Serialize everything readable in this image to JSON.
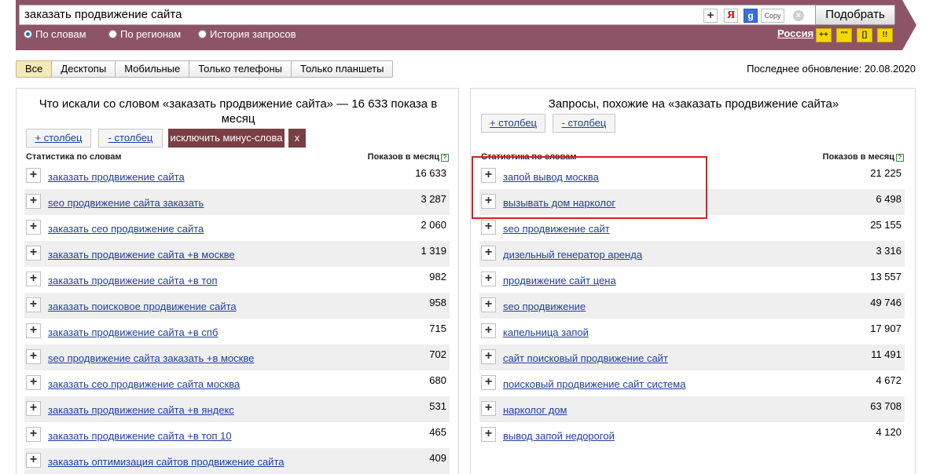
{
  "search": {
    "query": "заказать продвижение сайта",
    "plus_label": "+",
    "yandex_label": "Я",
    "google_label": "g",
    "copy_label": "Copy",
    "clear_label": "×",
    "submit_label": "Подобрать"
  },
  "modes": [
    {
      "label": "По словам",
      "selected": true
    },
    {
      "label": "По регионам",
      "selected": false
    },
    {
      "label": "История запросов",
      "selected": false
    }
  ],
  "region": "Россия",
  "operators": [
    "++",
    "\"\"",
    "[]",
    "!!"
  ],
  "tabs": [
    "Все",
    "Десктопы",
    "Мобильные",
    "Только телефоны",
    "Только планшеты"
  ],
  "active_tab": 0,
  "last_update": "Последнее обновление: 20.08.2020",
  "left": {
    "title": "Что искали со словом «заказать продвижение сайта» — 16 633 показа в месяц",
    "add_col": "+ столбец",
    "remove_col": "- столбец",
    "exclude_minus": "исключить минус-слова",
    "exclude_close": "x",
    "head_left": "Статистика по словам",
    "head_right": "Показов в месяц",
    "rows": [
      {
        "kw": "заказать продвижение сайта",
        "count": "16 633"
      },
      {
        "kw": "seo продвижение сайта заказать",
        "count": "3 287"
      },
      {
        "kw": "заказать сео продвижение сайта",
        "count": "2 060"
      },
      {
        "kw": "заказать продвижение сайта +в москве",
        "count": "1 319"
      },
      {
        "kw": "заказать продвижение сайта +в топ",
        "count": "982"
      },
      {
        "kw": "заказать поисковое продвижение сайта",
        "count": "958"
      },
      {
        "kw": "заказать продвижение сайта +в спб",
        "count": "715"
      },
      {
        "kw": "seo продвижение сайта заказать +в москве",
        "count": "702"
      },
      {
        "kw": "заказать сео продвижение сайта москва",
        "count": "680"
      },
      {
        "kw": "заказать продвижение сайта +в яндекс",
        "count": "531"
      },
      {
        "kw": "заказать продвижение сайта +в топ 10",
        "count": "465"
      },
      {
        "kw": "заказать оптимизация сайтов продвижение сайта",
        "count": "409"
      }
    ]
  },
  "right": {
    "title": "Запросы, похожие на «заказать продвижение сайта»",
    "add_col": "+ столбец",
    "remove_col": "- столбец",
    "head_left": "Статистика по словам",
    "head_right": "Показов в месяц",
    "rows": [
      {
        "kw": "запой вывод москва",
        "count": "21 225"
      },
      {
        "kw": "вызывать дом нарколог",
        "count": "6 498"
      },
      {
        "kw": "seo продвижение сайт",
        "count": "25 155"
      },
      {
        "kw": "дизельный генератор аренда",
        "count": "3 316"
      },
      {
        "kw": "продвижение сайт цена",
        "count": "13 557"
      },
      {
        "kw": "seo продвижение",
        "count": "49 746"
      },
      {
        "kw": "капельница запой",
        "count": "17 907"
      },
      {
        "kw": "сайт поисковый продвижение сайт",
        "count": "11 491"
      },
      {
        "kw": "поисковый продвижение сайт система",
        "count": "4 672"
      },
      {
        "kw": "нарколог дом",
        "count": "63 708"
      },
      {
        "kw": "вывод запой недорогой",
        "count": "4 120"
      }
    ]
  },
  "colors": {
    "topbar": "#8d5468",
    "minus_button": "#7a3e45",
    "link": "#1e3fa0",
    "highlight": "#d81e1e",
    "active_tab": "#f6e9b8",
    "operator": "#f5d800"
  }
}
